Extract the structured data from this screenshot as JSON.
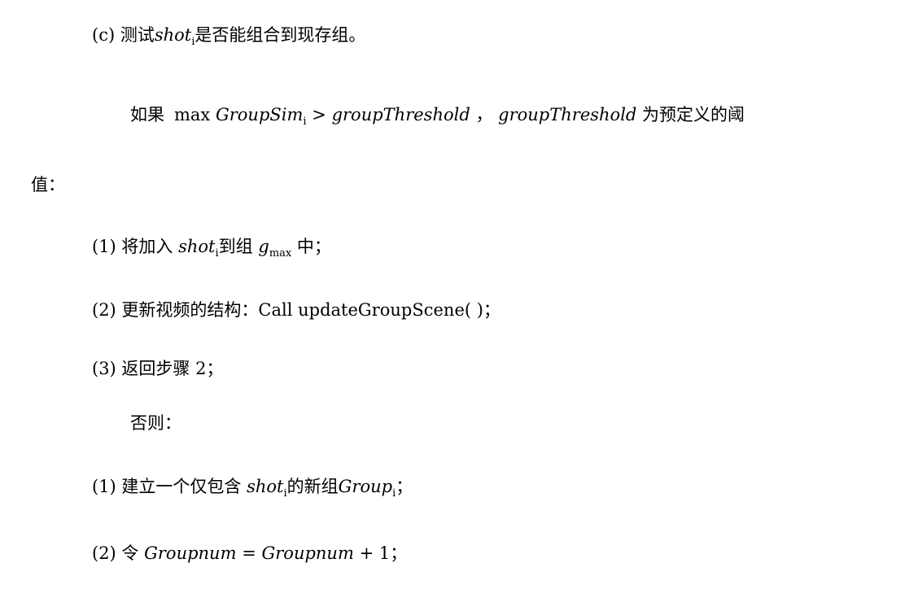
{
  "lines": {
    "step_c": {
      "prefix": "(c) 测试",
      "var": "shot",
      "sub": "i",
      "suffix": "是否能组合到现存组。"
    },
    "condition": {
      "prefix": "如果",
      "op_max": "max",
      "var": "GroupSim",
      "sub": "i",
      "gt": ">",
      "threshold": "groupThreshold",
      "comma": "，",
      "threshold2": "groupThreshold",
      "suffix": "为预定义的阈"
    },
    "condition_cont": "值：",
    "then_1": {
      "prefix": "(1) 将加入",
      "var": "shot",
      "sub": "i",
      "mid": "到组",
      "g": "g",
      "gsub": "max",
      "suffix": "中；"
    },
    "then_2": "(2) 更新视频的结构：Call updateGroupScene( )；",
    "then_3": "(3) 返回步骤 2；",
    "else": "否则：",
    "else_1": {
      "prefix": "(1) 建立一个仅包含",
      "var": "shot",
      "sub": "i",
      "mid": "的新组",
      "var2": "Group",
      "sub2": "i",
      "suffix": "；"
    },
    "else_2": {
      "prefix": "(2) 令",
      "var": "Groupnum",
      "eq": "=",
      "var2": "Groupnum",
      "plus": "+ 1",
      "suffix": "；"
    }
  }
}
